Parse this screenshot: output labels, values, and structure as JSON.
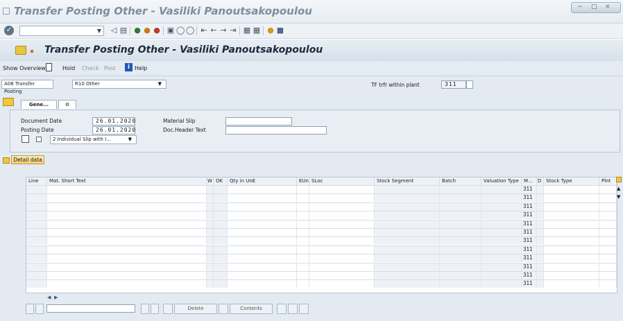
{
  "window": {
    "title": "Transfer Posting Other - Vasiliki Panoutsakopoulou",
    "controls": "− □ ×"
  },
  "system_toolbar": {
    "command_field_value": "",
    "icons": [
      "enter-icon",
      "back-icon",
      "save-icon",
      "back-nav-icon",
      "exit-icon",
      "cancel-icon",
      "print-icon",
      "find-icon",
      "find-next-icon",
      "first-page-icon",
      "prev-page-icon",
      "next-page-icon",
      "last-page-icon",
      "new-session-icon",
      "shortcut-icon",
      "help-icon",
      "customize-icon"
    ]
  },
  "header": {
    "title": "Transfer Posting Other - Vasiliki Panoutsakopoulou"
  },
  "app_toolbar": {
    "show_overview": "Show Overview",
    "hold": "Hold",
    "check": "Check",
    "post": "Post",
    "help": "Help"
  },
  "selection": {
    "transaction": "A08 Transfer Posting",
    "reference": "R10 Other",
    "movement_label": "TF trfr within plant",
    "movement_type": "311",
    "special_stock": ""
  },
  "tabs": {
    "general": "Gene..."
  },
  "general": {
    "document_date_label": "Document Date",
    "document_date": "26.01.2020",
    "posting_date_label": "Posting Date",
    "posting_date": "26.01.2020",
    "material_slip_label": "Material Slip",
    "material_slip": "",
    "doc_header_label": "Doc.Header Text",
    "doc_header": "",
    "print_version": "2 Individual Slip with I..."
  },
  "detail_data_button": "Detail data",
  "table": {
    "columns": [
      "Line",
      "Mat. Short Text",
      "W",
      "OK",
      "Qty in UnE",
      "EUn",
      "SLoc",
      "Stock Segment",
      "Batch",
      "Valuation Type",
      "M...",
      "D",
      "Stock Type",
      "Plnt"
    ],
    "movement_values": [
      "311",
      "311",
      "311",
      "311",
      "311",
      "311",
      "311",
      "311",
      "311",
      "311",
      "311",
      "311"
    ]
  },
  "bottom_toolbar": {
    "delete": "Delete",
    "contents": "Contents"
  }
}
